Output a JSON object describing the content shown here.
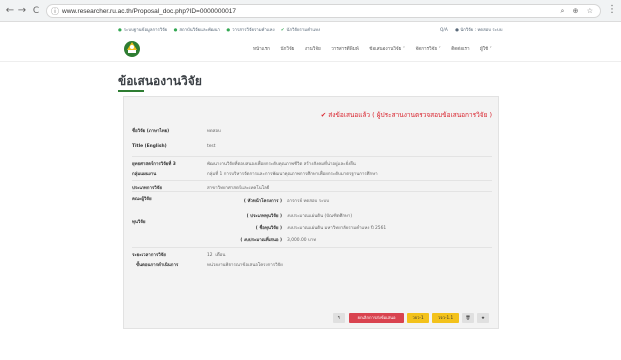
{
  "browser": {
    "back_glyph": "←",
    "forward_glyph": "→",
    "reload_glyph": "C",
    "info_glyph": "ⓘ",
    "url": "www.researcher.ru.ac.th/Proposal_doc.php?ID=0000000017",
    "right_icons": "⌕ ⊕ ☆",
    "menu_glyph": "⋮"
  },
  "topbar": {
    "links": [
      "ระบบฐานข้อมูลการวิจัย",
      "สถาบันวิจัยและพัฒนา",
      "วารสารวิจัยรามคำแหง",
      "นักวิจัยรามคำแหง"
    ],
    "qa": "Q/A",
    "user": "นักวิจัย : ทดสอบ ระบบ"
  },
  "nav": {
    "items": [
      "หน้าแรก",
      "นักวิจัย",
      "งานวิจัย",
      "วารสารตีพิมพ์",
      "ข้อเสนองานวิจัย ˅",
      "จัดการวิจัย ˅",
      "ติดต่อเรา",
      "ผู้ใช้ ˅"
    ]
  },
  "page": {
    "title": "ข้อเสนองานวิจัย",
    "status": "ส่งข้อเสนอแล้ว ( ผู้ประสานงานตรวจสอบข้อเสนอการวิจัย )",
    "status_glyph": "✔"
  },
  "fields": {
    "title_th_label": "ชื่อวิจัย (ภาษาไทย)",
    "title_th_value": "ทดสอบ",
    "title_en_label": "Title (English)",
    "title_en_value": "test",
    "strategy_label": "ยุทธศาสตร์การวิจัยที่ 3",
    "strategy_value": "พัฒนางานวิจัยที่ตอบสนองเพื่อยกระดับคุณภาพชีวิต สร้างสังคมที่น่าอยู่และยั่งยืน",
    "program_label": "กลุ่มแผนงาน",
    "program_value": "กลุ่มที่ 1 การบริหารจัดการและการพัฒนาคุณภาพการศึกษาเพื่อยกระดับมาตรฐานการศึกษา",
    "type_label": "ประเภทการวิจัย",
    "type_value": "สาขาวิทยาศาสตร์และเทคโนโลยี",
    "team_label": "คณะผู้วิจัย",
    "team_head_label": "( หัวหน้าโครงการ )",
    "team_head_value": "อาจารย์ ทดสอบ ระบบ",
    "fund_label": "ทุนวิจัย",
    "fund_type_label": "( ประเภททุนวิจัย )",
    "fund_type_value": "งบประมาณแผ่นดิน (บัณฑิตศึกษา)",
    "fund_name_label": "( ชื่อทุนวิจัย )",
    "fund_name_value": "งบประมาณแผ่นดิน มหาวิทยาลัยรามคำแหง ปี 2561",
    "budget_label": "( งบประมาณที่เสนอ )",
    "budget_value": "3,000.00",
    "budget_unit": "บาท",
    "duration_label": "ระยะเวลาการวิจัย",
    "duration_value": "12",
    "duration_unit": "เดือน",
    "steps_label": "ขั้นตอนการดำเนินการ",
    "steps_value": "หน่วยงานพิจารณาข้อเสนอโครงการวิจัย"
  },
  "buttons": {
    "back_glyph": "↰",
    "cancel_label": "ยกเลิกการส่งข้อเสนอ",
    "form1_label": "วจว-1",
    "form11_label": "วจว-1.1",
    "delete_glyph": "🗑",
    "star_glyph": "★"
  },
  "colors": {
    "accent_red": "#d9252f",
    "button_yellow": "#f3c21b",
    "title_underline": "#2e7d32"
  }
}
